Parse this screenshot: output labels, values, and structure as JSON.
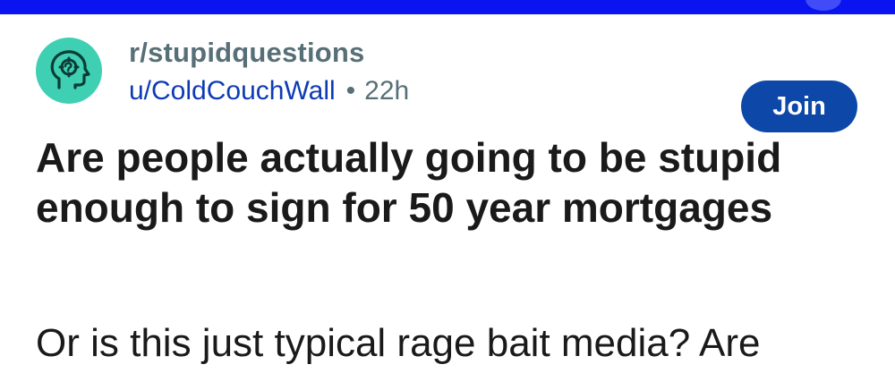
{
  "colors": {
    "top_bar": "#0a14f0",
    "community_avatar_bg": "#3fd0b4",
    "subreddit_text": "#576f76",
    "author_link": "#0d3bb5",
    "join_button_bg": "#0d48a8",
    "join_button_text": "#ffffff",
    "body_text": "#1a1a1b"
  },
  "header": {
    "avatar_icon": "head-with-gear-icon",
    "subreddit": "r/stupidquestions",
    "author": "u/ColdCouchWall",
    "separator": "•",
    "age": "22h",
    "join_label": "Join"
  },
  "post": {
    "title": "Are people actually going to be stupid enough to sign for 50 year mortgages",
    "body": "Or is this just typical rage bait media? Are"
  }
}
